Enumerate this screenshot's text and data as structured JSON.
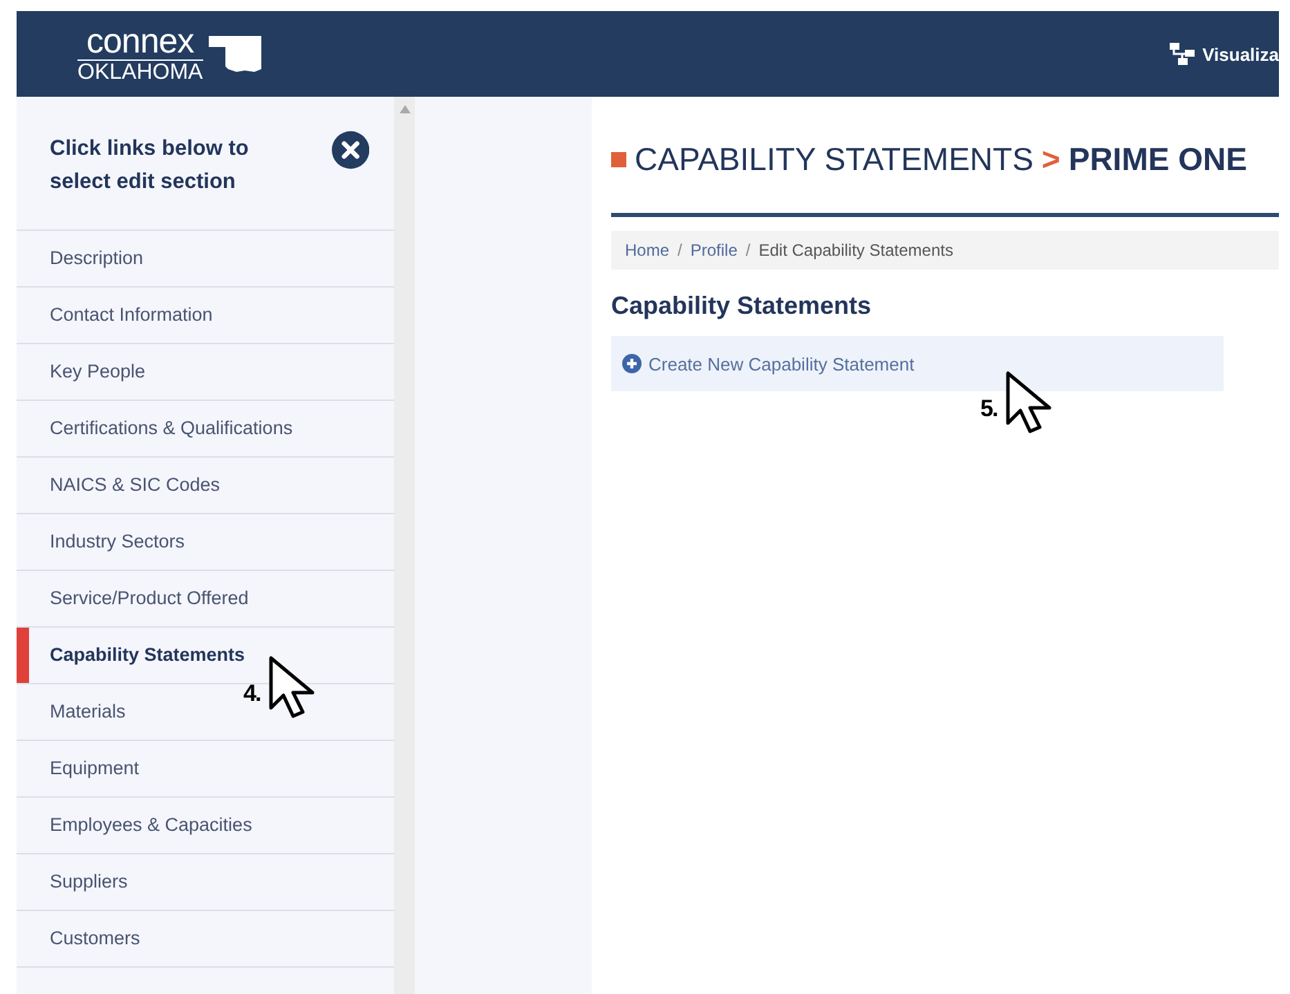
{
  "header": {
    "logo_top": "connex",
    "logo_bottom": "OKLAHOMA",
    "nav_link": "Visualiza"
  },
  "sidebar": {
    "prompt": "Click links below to select edit section",
    "items": [
      {
        "label": "Description",
        "selected": false
      },
      {
        "label": "Contact Information",
        "selected": false
      },
      {
        "label": "Key People",
        "selected": false
      },
      {
        "label": "Certifications & Qualifications",
        "selected": false
      },
      {
        "label": "NAICS & SIC Codes",
        "selected": false
      },
      {
        "label": "Industry Sectors",
        "selected": false
      },
      {
        "label": "Service/Product Offered",
        "selected": false
      },
      {
        "label": "Capability Statements",
        "selected": true
      },
      {
        "label": "Materials",
        "selected": false
      },
      {
        "label": "Equipment",
        "selected": false
      },
      {
        "label": "Employees & Capacities",
        "selected": false
      },
      {
        "label": "Suppliers",
        "selected": false
      },
      {
        "label": "Customers",
        "selected": false
      }
    ]
  },
  "main": {
    "title": "CAPABILITY STATEMENTS",
    "separator": ">",
    "title_strong": "PRIME ONE",
    "breadcrumb_separator": "/",
    "breadcrumb": [
      {
        "label": "Home",
        "current": false
      },
      {
        "label": "Profile",
        "current": false
      },
      {
        "label": "Edit Capability Statements",
        "current": true
      }
    ],
    "heading": "Capability Statements",
    "action": "Create New Capability Statement"
  },
  "annotations": [
    {
      "label": "4."
    },
    {
      "label": "5."
    }
  ]
}
